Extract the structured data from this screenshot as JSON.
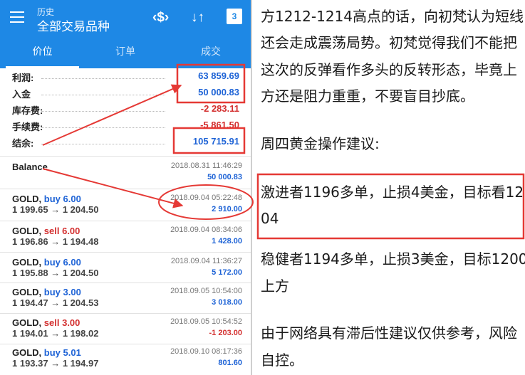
{
  "app": {
    "title_small": "历史",
    "title_main": "全部交易品种",
    "tabs": [
      "价位",
      "订单",
      "成交"
    ],
    "active_tab": 0,
    "icons": [
      "menu-icon",
      "currency-exchange-icon",
      "sort-icon",
      "calendar-icon"
    ],
    "calendar_day": "3",
    "accent_color": "#1e88e5",
    "summary": [
      {
        "label": "利润:",
        "value": "63 859.69",
        "boxed": true
      },
      {
        "label": "入金",
        "value": "50 000.83",
        "boxed": true
      },
      {
        "label": "库存费:",
        "value": "-2 283.11",
        "boxed": false
      },
      {
        "label": "手续费:",
        "value": "-5 861.50",
        "boxed": false
      },
      {
        "label": "结余:",
        "value": "105 715.91",
        "boxed": true
      }
    ],
    "balance": {
      "label": "Balance",
      "time": "2018.08.31 11:46:29",
      "amount": "50 000.83"
    },
    "trades": [
      {
        "symbol": "GOLD,",
        "side": "buy 6.00",
        "prices": "1 199.65 → 1 204.50",
        "time": "2018.09.04 05:22:48",
        "pl": "2 910.00"
      },
      {
        "symbol": "GOLD,",
        "side": "sell 6.00",
        "prices": "1 196.86 → 1 194.48",
        "time": "2018.09.04 08:34:06",
        "pl": "1 428.00"
      },
      {
        "symbol": "GOLD,",
        "side": "buy 6.00",
        "prices": "1 195.88 → 1 204.50",
        "time": "2018.09.04 11:36:27",
        "pl": "5 172.00"
      },
      {
        "symbol": "GOLD,",
        "side": "buy 3.00",
        "prices": "1 194.47 → 1 204.53",
        "time": "2018.09.05 10:54:00",
        "pl": "3 018.00"
      },
      {
        "symbol": "GOLD,",
        "side": "sell 3.00",
        "prices": "1 194.01 → 1 198.02",
        "time": "2018.09.05 10:54:52",
        "pl": "-1 203.00"
      },
      {
        "symbol": "GOLD,",
        "side": "buy 5.01",
        "prices": "1 193.37 → 1 194.97",
        "time": "2018.09.10 08:17:36",
        "pl": "801.60"
      }
    ]
  },
  "article": {
    "lines": [
      "方1212-1214高点的话，向初梵认为短线",
      "还会走成震荡局势。初梵觉得我们不能把",
      "这次的反弹看作多头的反转形态，毕竟上",
      "方还是阻力重重，不要盲目抄底。",
      "周四黄金操作建议:",
      "激进者1196多单，止损4美金，目标看12",
      "04",
      "稳健者1194多单，止损3美金，目标1200",
      "上方",
      "由于网络具有滞后性建议仅供参考，风险",
      "自控。"
    ]
  },
  "annotation_color": "#e53935"
}
